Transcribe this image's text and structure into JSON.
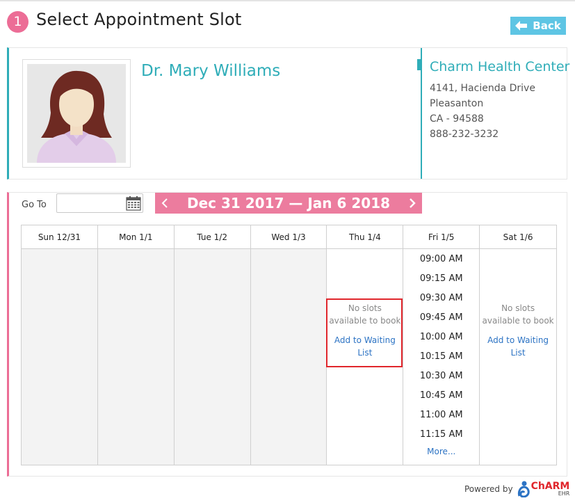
{
  "header": {
    "step_number": "1",
    "title": "Select Appointment Slot",
    "back_label": "Back"
  },
  "provider": {
    "name": "Dr. Mary Williams",
    "photo_icon": "female-avatar"
  },
  "clinic": {
    "name": "Charm Health Center",
    "address_line1": "4141, Hacienda Drive",
    "address_line2": "Pleasanton",
    "address_line3": "CA - 94588",
    "phone": "888-232-3232"
  },
  "calendar": {
    "goto_label": "Go To",
    "goto_value": "",
    "week_range": "Dec 31 2017 — Jan 6 2018",
    "days": [
      {
        "label": "Sun 12/31",
        "state": "unavailable"
      },
      {
        "label": "Mon 1/1",
        "state": "unavailable"
      },
      {
        "label": "Tue 1/2",
        "state": "unavailable"
      },
      {
        "label": "Wed 1/3",
        "state": "unavailable"
      },
      {
        "label": "Thu 1/4",
        "state": "no-slots",
        "no_slots_text": "No slots available to book",
        "waitlist_text": "Add to Waiting List"
      },
      {
        "label": "Fri 1/5",
        "state": "slots",
        "slots": [
          "09:00 AM",
          "09:15 AM",
          "09:30 AM",
          "09:45 AM",
          "10:00 AM",
          "10:15 AM",
          "10:30 AM",
          "10:45 AM",
          "11:00 AM",
          "11:15 AM"
        ],
        "more_text": "More..."
      },
      {
        "label": "Sat 1/6",
        "state": "no-slots",
        "no_slots_text": "No slots available to book",
        "waitlist_text": "Add to Waiting List"
      }
    ]
  },
  "footer": {
    "powered_by": "Powered by",
    "brand_name": "ChARM",
    "brand_sub": "EHR"
  },
  "colors": {
    "teal": "#2fadb8",
    "pink": "#ec6d96",
    "back_button": "#5ec5e4",
    "link": "#2c73c4",
    "highlight": "#e0262c"
  }
}
